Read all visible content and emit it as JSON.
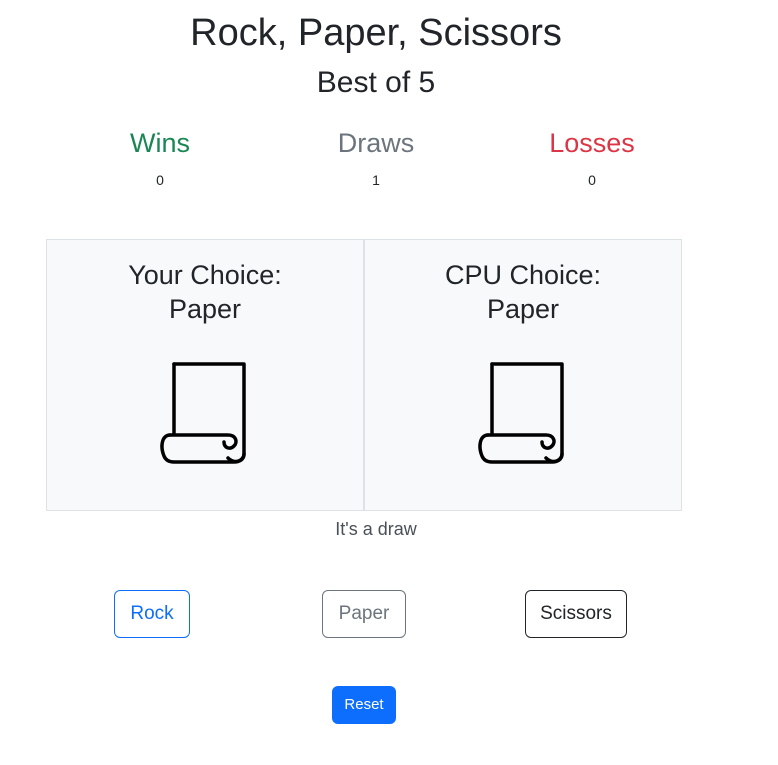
{
  "header": {
    "title": "Rock, Paper, Scissors",
    "subtitle": "Best of 5"
  },
  "scoreboard": {
    "wins": {
      "label": "Wins",
      "value": "0",
      "color": "#198754"
    },
    "draws": {
      "label": "Draws",
      "value": "1",
      "color": "#6c757d"
    },
    "losses": {
      "label": "Losses",
      "value": "0",
      "color": "#dc3545"
    }
  },
  "player": {
    "heading": "Your Choice:",
    "choice": "Paper",
    "icon": "paper-scroll-icon"
  },
  "cpu": {
    "heading": "CPU Choice:",
    "choice": "Paper",
    "icon": "paper-scroll-icon"
  },
  "result": {
    "text": "It's a draw"
  },
  "controls": {
    "rock_label": "Rock",
    "paper_label": "Paper",
    "scissors_label": "Scissors",
    "reset_label": "Reset"
  },
  "colors": {
    "primary": "#0d6efd",
    "secondary": "#6c757d",
    "dark": "#212529",
    "panel_bg": "#f8f9fa"
  }
}
